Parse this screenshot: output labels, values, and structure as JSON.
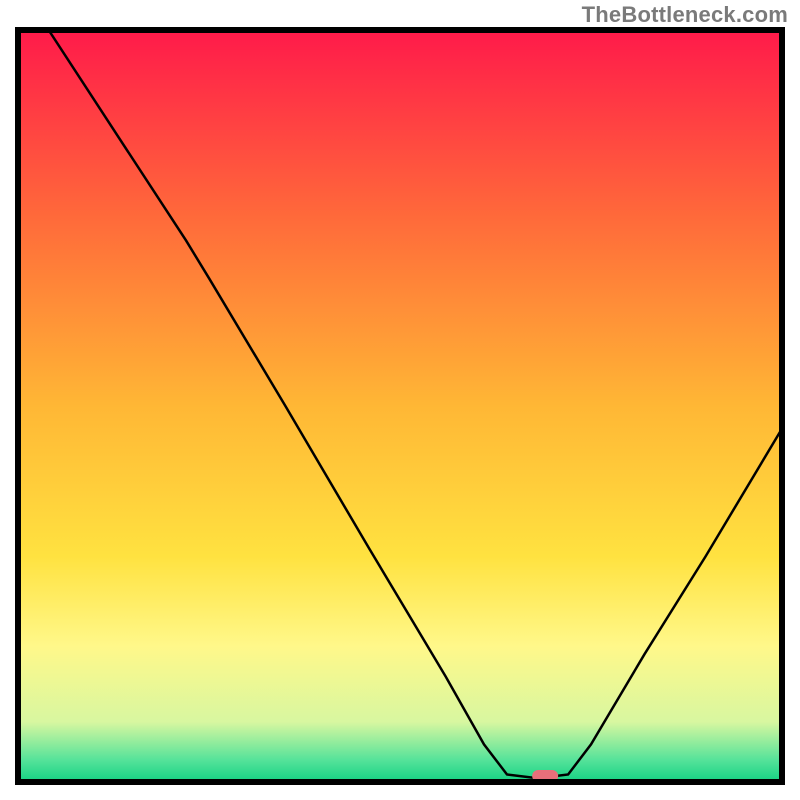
{
  "attribution": "TheBottleneck.com",
  "chart_data": {
    "type": "line",
    "title": "",
    "xlabel": "",
    "ylabel": "",
    "xlim": [
      0,
      100
    ],
    "ylim": [
      0,
      100
    ],
    "grid": false,
    "legend": false,
    "background": {
      "type": "vertical-gradient",
      "comment": "red at top through orange, yellow, to green at bottom",
      "stops": [
        {
          "pos": 0.0,
          "color": "#ff1a4a"
        },
        {
          "pos": 0.25,
          "color": "#ff6a3a"
        },
        {
          "pos": 0.5,
          "color": "#ffb735"
        },
        {
          "pos": 0.7,
          "color": "#ffe240"
        },
        {
          "pos": 0.82,
          "color": "#fff88a"
        },
        {
          "pos": 0.92,
          "color": "#d8f7a0"
        },
        {
          "pos": 0.97,
          "color": "#57e39a"
        },
        {
          "pos": 1.0,
          "color": "#14d183"
        }
      ]
    },
    "series": [
      {
        "name": "bottleneck-curve",
        "comment": "x in percent of plot width, y in percent of plot height (0 = bottom, 100 = top). Curve descends steeply from top-left, flattens near bottom around x≈65-70, then rises toward right edge.",
        "points": [
          {
            "x": 4,
            "y": 100
          },
          {
            "x": 13,
            "y": 86
          },
          {
            "x": 22,
            "y": 72
          },
          {
            "x": 25,
            "y": 67
          },
          {
            "x": 35,
            "y": 50
          },
          {
            "x": 46,
            "y": 31
          },
          {
            "x": 56,
            "y": 14
          },
          {
            "x": 61,
            "y": 5
          },
          {
            "x": 64,
            "y": 1
          },
          {
            "x": 68,
            "y": 0.5
          },
          {
            "x": 72,
            "y": 1
          },
          {
            "x": 75,
            "y": 5
          },
          {
            "x": 82,
            "y": 17
          },
          {
            "x": 90,
            "y": 30
          },
          {
            "x": 100,
            "y": 47
          }
        ]
      }
    ],
    "marker": {
      "comment": "small rounded pink pill at the curve minimum",
      "x": 69,
      "y": 0.8,
      "color": "#e86f7a"
    },
    "frame": {
      "comment": "thick black border around plotting area",
      "stroke": "#000000",
      "width": 6
    }
  }
}
